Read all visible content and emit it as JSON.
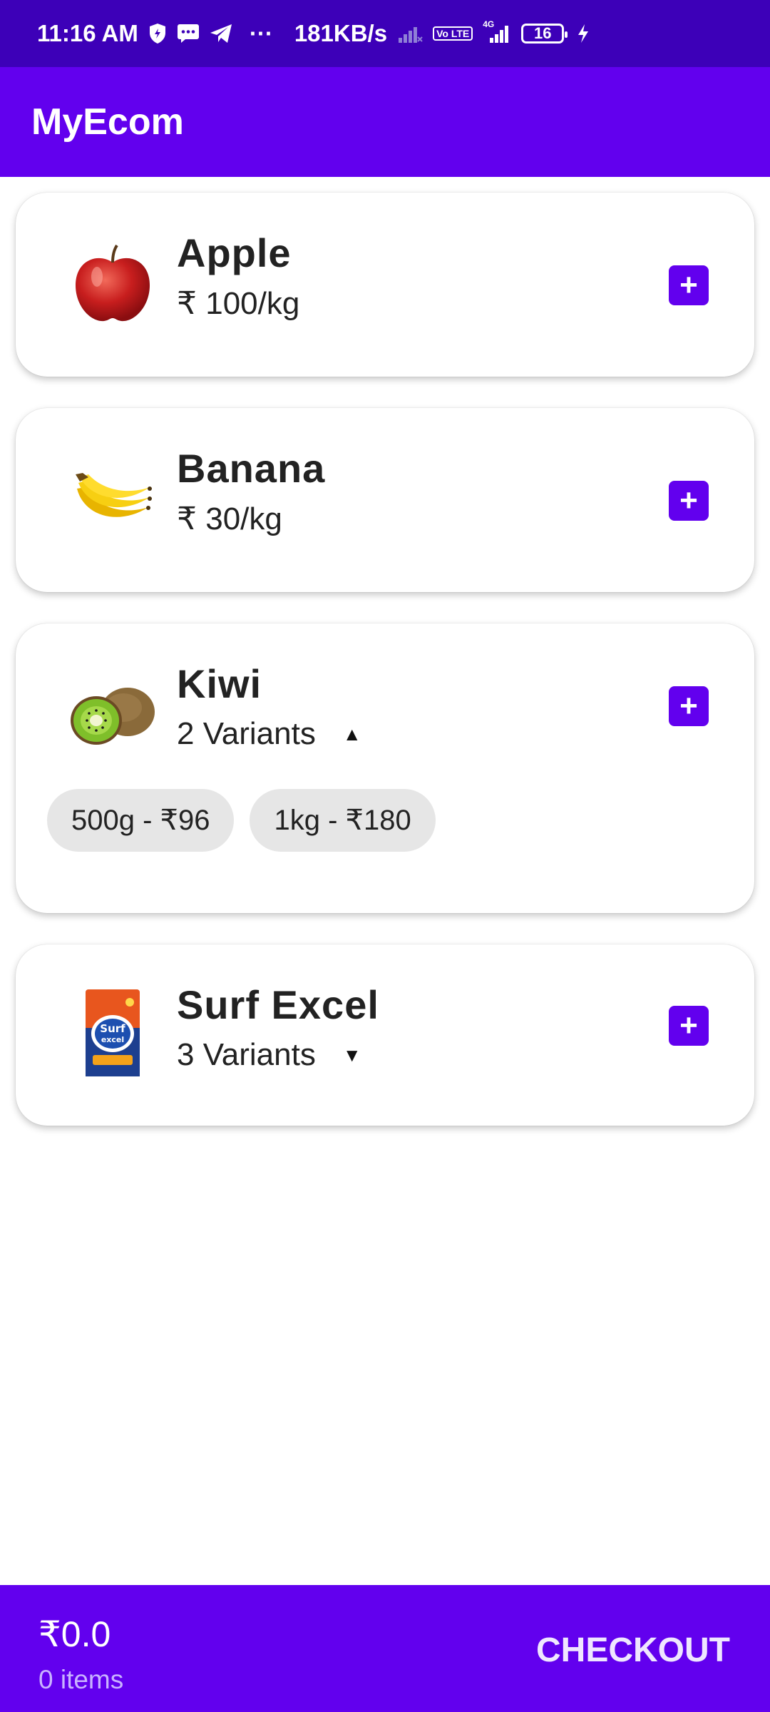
{
  "status_bar": {
    "time": "11:16 AM",
    "more": "···",
    "speed": "181KB/s",
    "lte": "Vo LTE",
    "net": "4G",
    "battery": "16"
  },
  "app": {
    "title": "MyEcom"
  },
  "products": [
    {
      "name": "Apple",
      "price": "₹ 100/kg",
      "add_label": "+",
      "icon": "apple-image"
    },
    {
      "name": "Banana",
      "price": "₹ 30/kg",
      "add_label": "+",
      "icon": "banana-image"
    },
    {
      "name": "Kiwi",
      "variants_label": "2 Variants",
      "add_label": "+",
      "icon": "kiwi-image",
      "variants": [
        "500g - ₹96",
        "1kg - ₹180"
      ],
      "expanded": true
    },
    {
      "name": "Surf Excel",
      "variants_label": "3 Variants",
      "add_label": "+",
      "icon": "surf-excel-image",
      "expanded": false
    }
  ],
  "cart": {
    "total": "₹0.0",
    "count": "0 items",
    "checkout_label": "CHECKOUT"
  },
  "colors": {
    "primary": "#6200ee",
    "status_bar": "#3d00b8",
    "chip_bg": "#e6e6e6"
  }
}
